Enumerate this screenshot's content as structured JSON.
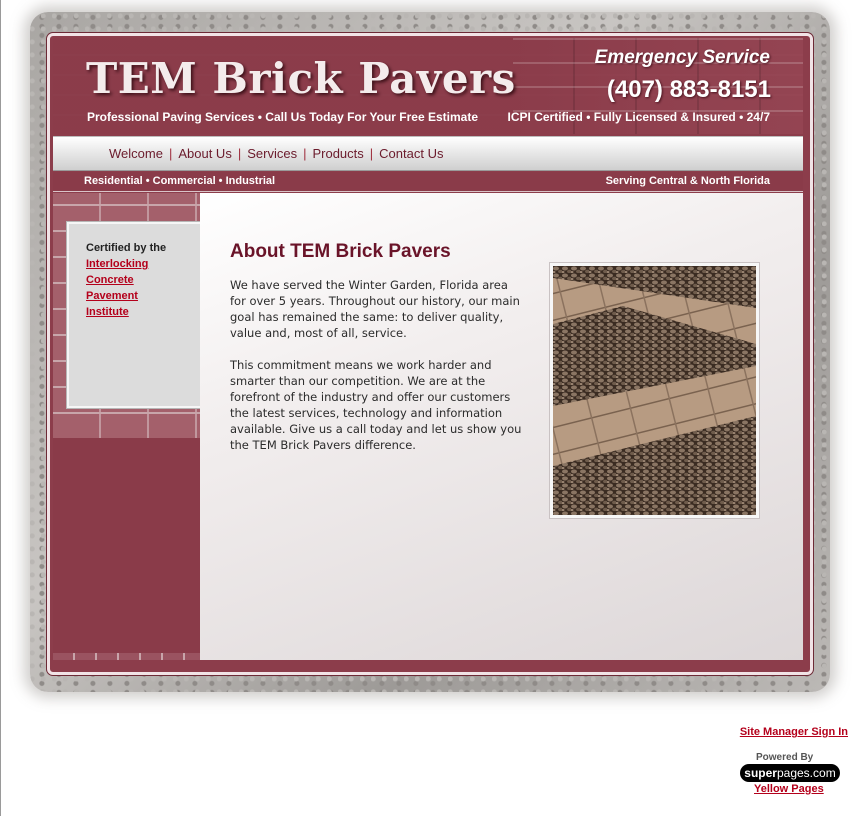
{
  "header": {
    "site_title": "TEM Brick Pavers",
    "tagline": "Professional Paving Services • Call Us Today For Your Free Estimate",
    "emergency_label": "Emergency Service",
    "phone": "(407) 883-8151",
    "certifications": "ICPI  Certified • Fully Licensed & Insured • 24/7"
  },
  "nav": {
    "items": [
      {
        "label": "Welcome"
      },
      {
        "label": "About Us"
      },
      {
        "label": "Services"
      },
      {
        "label": "Products"
      },
      {
        "label": "Contact Us"
      }
    ],
    "separator": "|"
  },
  "strip": {
    "left": "Residential • Commercial • Industrial",
    "right": "Serving Central & North Florida"
  },
  "sidebar": {
    "cert_intro": "Certified by the",
    "cert_link_lines": [
      "Interlocking",
      "Concrete",
      "Pavement",
      "Institute"
    ]
  },
  "content": {
    "title": "About TEM Brick Pavers",
    "paragraph1": "We have served the Winter Garden, Florida area for over 5 years. Throughout our history, our main goal has remained the same: to deliver quality, value and, most of all, service.",
    "paragraph2": "This commitment means we work harder and smarter than our competition. We are at the forefront of the industry and offer our customers the latest services, technology and information available. Give us a call today and let us show you the TEM Brick Pavers difference."
  },
  "footer": {
    "site_manager": "Site Manager Sign In",
    "powered_by": "Powered By",
    "logo_text_bold": "super",
    "logo_text_rest": "pages.com",
    "yellow_pages": "Yellow Pages"
  },
  "colors": {
    "brand_maroon": "#8c3d4b",
    "nav_text": "#6b1b2c",
    "title_text": "#6a1429",
    "link_red": "#b4001b"
  }
}
